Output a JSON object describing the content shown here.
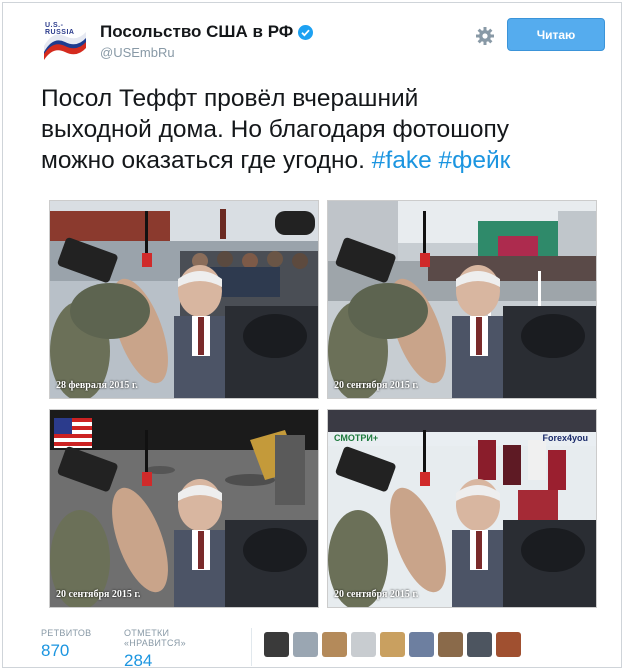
{
  "account": {
    "display_name": "Посольство США в РФ",
    "handle": "@USEmbRu",
    "avatar_text": "U.S.-RUSSIA"
  },
  "actions": {
    "follow_label": "Читаю"
  },
  "tweet": {
    "text_line1": "Посол Теффт провёл вчерашний",
    "text_line2": "выходной дома. Но благодаря фотошопу",
    "text_line3_plain": "можно оказаться где угодно. ",
    "hashtag1": "#fake",
    "hashtag2": "#фейк"
  },
  "photos": [
    {
      "caption": "28 февраля 2015 г."
    },
    {
      "caption": "20 сентября 2015 г."
    },
    {
      "caption": "20 сентября 2015 г."
    },
    {
      "caption": "20 сентября 2015 г."
    }
  ],
  "photo3_banner": {
    "left": "СМОТРИ+",
    "right": "Forex4you"
  },
  "stats": {
    "retweets_label": "РЕТВИТОВ",
    "retweets_value": "870",
    "likes_label": "ОТМЕТКИ «НРАВИТСЯ»",
    "likes_value": "284"
  },
  "colors": {
    "accent": "#55acee",
    "link": "#1b95e0"
  },
  "icons": [
    "verified-badge-icon",
    "gear-icon"
  ]
}
